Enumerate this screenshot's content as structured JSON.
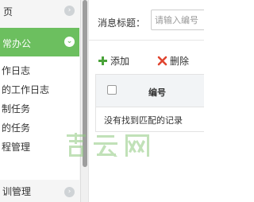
{
  "sidebar": {
    "home_label": "页",
    "office_group_label": "常办公",
    "office_items": [
      "作日志",
      "的工作日志",
      "制任务",
      "的任务",
      "程管理"
    ],
    "training_label": "训管理",
    "home_icon": "chevron-right-icon",
    "office_icon": "chevron-down-icon",
    "training_icon": "chevron-right-icon"
  },
  "search": {
    "label": "消息标题：",
    "placeholder": "请输入编号"
  },
  "toolbar": {
    "add_label": "添加",
    "delete_label": "删除",
    "add_icon": "plus-icon",
    "delete_icon": "x-icon",
    "add_color": "#4aa33a",
    "delete_color": "#e0442f"
  },
  "table": {
    "columns": [
      "编号"
    ],
    "empty_message": "没有找到匹配的记录"
  },
  "watermark": {
    "text": "吉云网"
  },
  "colors": {
    "accent": "#6cbf5f",
    "sidebar_bg": "#f5f5f5",
    "header_bg": "#f2f4f6"
  }
}
